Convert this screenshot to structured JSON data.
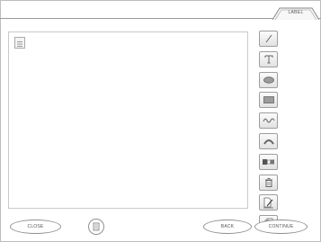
{
  "header": {
    "tab_label": "LABEL"
  },
  "toolbar": {
    "tools": [
      {
        "name": "line-tool",
        "icon": "line-icon"
      },
      {
        "name": "text-tool",
        "icon": "text-icon"
      },
      {
        "name": "ellipse-tool",
        "icon": "ellipse-icon"
      },
      {
        "name": "rectangle-tool",
        "icon": "rectangle-icon"
      },
      {
        "name": "freehand-tool",
        "icon": "wave-icon"
      },
      {
        "name": "arc-tool",
        "icon": "arc-icon"
      },
      {
        "name": "color-tool",
        "icon": "color-swatch-icon"
      },
      {
        "name": "delete-tool",
        "icon": "trash-icon"
      },
      {
        "name": "edit-tool",
        "icon": "edit-icon"
      },
      {
        "name": "copy-tool",
        "icon": "copy-icon"
      }
    ]
  },
  "footer": {
    "close_label": "CLOSE",
    "back_label": "BACK",
    "continue_label": "CONTINUE"
  }
}
